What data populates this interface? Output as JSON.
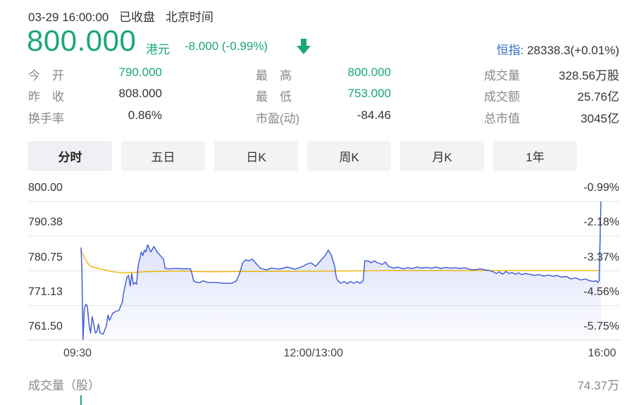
{
  "header": {
    "datetime": "03-29 16:00:00",
    "status": "已收盘",
    "timezone": "北京时间",
    "price": "800.000",
    "currency": "港元",
    "change": "-8.000 (-0.99%)",
    "index_name": "恒指:",
    "index_value": "28338.3(+0.01%)"
  },
  "stats": [
    {
      "label": "今　开",
      "value": "790.000",
      "green": true
    },
    {
      "label": "最　高",
      "value": "800.000",
      "green": true
    },
    {
      "label": "成交量",
      "value": "328.56万股",
      "green": false
    },
    {
      "label": "昨　收",
      "value": "808.000",
      "green": false
    },
    {
      "label": "最　低",
      "value": "753.000",
      "green": true
    },
    {
      "label": "成交额",
      "value": "25.76亿",
      "green": false
    },
    {
      "label": "换手率",
      "value": "0.86%",
      "green": false
    },
    {
      "label": "市盈(动)",
      "value": "-84.46",
      "green": false
    },
    {
      "label": "总市值",
      "value": "3045亿",
      "green": false
    }
  ],
  "tabs": [
    "分时",
    "五日",
    "日K",
    "周K",
    "月K",
    "1年"
  ],
  "volume": {
    "label": "成交量（股）",
    "max": "74.37万"
  },
  "colors": {
    "price_line": "#3b57d6",
    "avg_line": "#f0b400",
    "down": "#1aa67a"
  },
  "chart_data": {
    "type": "line",
    "y_left_ticks": [
      "800.00",
      "790.38",
      "780.75",
      "771.13",
      "761.50"
    ],
    "y_right_ticks": [
      "-0.99%",
      "-2.18%",
      "-3.37%",
      "-4.56%",
      "-5.75%"
    ],
    "ylim": [
      761.5,
      800.0
    ],
    "x_ticks": [
      {
        "label": "09:30",
        "t": 0
      },
      {
        "label": "12:00/13:00",
        "t": 150
      },
      {
        "label": "16:00",
        "t": 330
      }
    ],
    "x_range_minutes": [
      0,
      340
    ],
    "series": [
      {
        "kind": "price",
        "points": [
          [
            0,
            787.2
          ],
          [
            0.6,
            781.0
          ],
          [
            1.3,
            761.5
          ],
          [
            2,
            770.0
          ],
          [
            3,
            771.5
          ],
          [
            4,
            771.0
          ],
          [
            5,
            766.0
          ],
          [
            6,
            763.5
          ],
          [
            7,
            768.0
          ],
          [
            8,
            766.0
          ],
          [
            9,
            763.5
          ],
          [
            10,
            763.8
          ],
          [
            11,
            766.0
          ],
          [
            12,
            763.5
          ],
          [
            14,
            763.2
          ],
          [
            16,
            765.5
          ],
          [
            17,
            768.5
          ],
          [
            18,
            767.0
          ],
          [
            20,
            769.0
          ],
          [
            22,
            769.5
          ],
          [
            24,
            769.8
          ],
          [
            25,
            771.0
          ],
          [
            26,
            772.0
          ],
          [
            27,
            775.0
          ],
          [
            28,
            777.0
          ],
          [
            29,
            779.0
          ],
          [
            30,
            779.5
          ],
          [
            31,
            776.5
          ],
          [
            32,
            780.0
          ],
          [
            33,
            777.0
          ],
          [
            34,
            777.5
          ],
          [
            35,
            777.0
          ],
          [
            36,
            782.0
          ],
          [
            37,
            784.0
          ],
          [
            38,
            786.0
          ],
          [
            39,
            785.0
          ],
          [
            40,
            786.5
          ],
          [
            41,
            786.0
          ],
          [
            42,
            788.0
          ],
          [
            44,
            786.0
          ],
          [
            46,
            787.5
          ],
          [
            48,
            786.0
          ],
          [
            50,
            785.0
          ],
          [
            52,
            784.0
          ],
          [
            53,
            781.5
          ],
          [
            55,
            781.3
          ],
          [
            60,
            781.4
          ],
          [
            65,
            781.3
          ],
          [
            69,
            781.3
          ],
          [
            70,
            780.0
          ],
          [
            71,
            778.0
          ],
          [
            73,
            777.5
          ],
          [
            75,
            777.5
          ],
          [
            77,
            778.0
          ],
          [
            80,
            777.5
          ],
          [
            85,
            777.5
          ],
          [
            90,
            777.3
          ],
          [
            95,
            777.3
          ],
          [
            98,
            778.0
          ],
          [
            100,
            780.0
          ],
          [
            102,
            783.0
          ],
          [
            104,
            783.8
          ],
          [
            106,
            783.5
          ],
          [
            108,
            784.0
          ],
          [
            110,
            783.0
          ],
          [
            113,
            781.5
          ],
          [
            117,
            781.0
          ],
          [
            120,
            781.5
          ],
          [
            125,
            781.2
          ],
          [
            130,
            781.8
          ],
          [
            135,
            781.2
          ],
          [
            140,
            782.0
          ],
          [
            142,
            782.5
          ],
          [
            145,
            783.0
          ],
          [
            148,
            782.0
          ],
          [
            150,
            783.0
          ],
          [
            152,
            784.0
          ],
          [
            154,
            785.0
          ],
          [
            156,
            786.5
          ],
          [
            158,
            785.0
          ],
          [
            160,
            782.0
          ],
          [
            161,
            779.0
          ],
          [
            162,
            778.0
          ],
          [
            164,
            777.3
          ],
          [
            166,
            777.8
          ],
          [
            168,
            777.2
          ],
          [
            170,
            777.8
          ],
          [
            172,
            777.3
          ],
          [
            174,
            777.8
          ],
          [
            176,
            777.3
          ],
          [
            178,
            778.0
          ],
          [
            179,
            783.5
          ],
          [
            181,
            783.5
          ],
          [
            183,
            783.0
          ],
          [
            185,
            783.5
          ],
          [
            187,
            783.0
          ],
          [
            190,
            782.5
          ],
          [
            192,
            783.2
          ],
          [
            194,
            782.0
          ],
          [
            197,
            781.5
          ],
          [
            200,
            781.8
          ],
          [
            203,
            781.3
          ],
          [
            206,
            781.6
          ],
          [
            209,
            781.4
          ],
          [
            212,
            781.8
          ],
          [
            215,
            781.5
          ],
          [
            218,
            781.7
          ],
          [
            221,
            781.5
          ],
          [
            224,
            781.8
          ],
          [
            227,
            781.4
          ],
          [
            230,
            781.7
          ],
          [
            233,
            781.5
          ],
          [
            236,
            781.6
          ],
          [
            239,
            781.4
          ],
          [
            242,
            781.6
          ],
          [
            245,
            781.2
          ],
          [
            248,
            781.0
          ],
          [
            252,
            781.3
          ],
          [
            255,
            781.0
          ],
          [
            258,
            780.8
          ],
          [
            260,
            780.5
          ],
          [
            262,
            780.0
          ],
          [
            264,
            780.5
          ],
          [
            266,
            779.8
          ],
          [
            268,
            780.6
          ],
          [
            270,
            780.0
          ],
          [
            272,
            780.3
          ],
          [
            274,
            779.8
          ],
          [
            276,
            780.2
          ],
          [
            278,
            779.7
          ],
          [
            280,
            780.0
          ],
          [
            283,
            779.8
          ],
          [
            286,
            779.5
          ],
          [
            289,
            779.7
          ],
          [
            292,
            779.3
          ],
          [
            295,
            779.6
          ],
          [
            298,
            779.2
          ],
          [
            300,
            779.5
          ],
          [
            303,
            779.0
          ],
          [
            306,
            779.2
          ],
          [
            309,
            778.5
          ],
          [
            312,
            778.8
          ],
          [
            315,
            778.2
          ],
          [
            318,
            778.5
          ],
          [
            321,
            778.0
          ],
          [
            323,
            777.8
          ],
          [
            325,
            778.0
          ],
          [
            326,
            777.5
          ],
          [
            326.8,
            778.0
          ],
          [
            328,
            800.0
          ]
        ]
      },
      {
        "kind": "average",
        "points": [
          [
            0,
            786.5
          ],
          [
            2,
            784.5
          ],
          [
            4,
            783.0
          ],
          [
            6,
            782.0
          ],
          [
            10,
            781.5
          ],
          [
            15,
            781.0
          ],
          [
            20,
            780.5
          ],
          [
            26,
            780.2
          ],
          [
            30,
            780.2
          ],
          [
            40,
            780.5
          ],
          [
            60,
            780.7
          ],
          [
            80,
            780.5
          ],
          [
            120,
            780.6
          ],
          [
            160,
            780.7
          ],
          [
            200,
            780.8
          ],
          [
            240,
            780.8
          ],
          [
            280,
            780.8
          ],
          [
            327,
            780.8
          ]
        ]
      }
    ]
  }
}
